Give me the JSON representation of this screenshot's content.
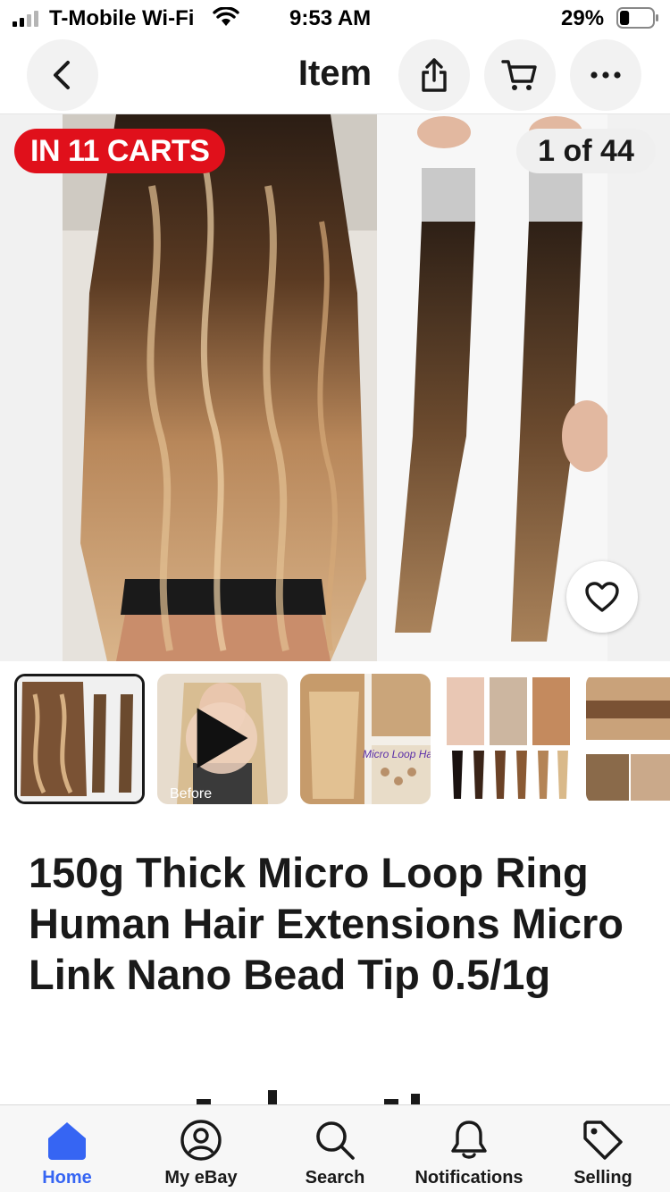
{
  "status_bar": {
    "carrier": "T-Mobile Wi-Fi",
    "time": "9:53 AM",
    "battery": "29%",
    "battery_level": 0.29
  },
  "header": {
    "title": "Item",
    "back_icon": "chevron-left-icon",
    "share_icon": "share-icon",
    "cart_icon": "cart-icon",
    "more_icon": "more-icon"
  },
  "gallery": {
    "carts_badge": "IN 11 CARTS",
    "counter": "1 of 44",
    "video_caption": "Before",
    "thumbnail_3_caption": "Micro Loop Hair",
    "watch_icon": "heart-icon"
  },
  "listing": {
    "title": "150g Thick Micro Loop Ring Human Hair Extensions Micro Link Nano Bead Tip 0.5/1g"
  },
  "colors": {
    "badge_red": "#e0101b",
    "accent_blue": "#3665f3",
    "text": "#191919"
  },
  "tabbar": {
    "tabs": [
      {
        "label": "Home",
        "icon": "home-icon",
        "active": true
      },
      {
        "label": "My eBay",
        "icon": "user-icon",
        "active": false
      },
      {
        "label": "Search",
        "icon": "search-icon",
        "active": false
      },
      {
        "label": "Notifications",
        "icon": "bell-icon",
        "active": false
      },
      {
        "label": "Selling",
        "icon": "tag-icon",
        "active": false
      }
    ]
  }
}
